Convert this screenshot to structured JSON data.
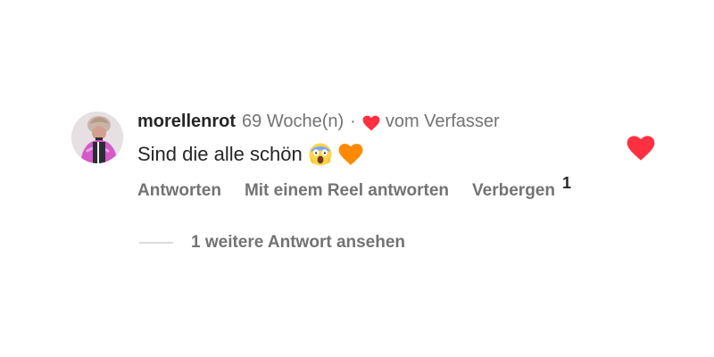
{
  "comment": {
    "username": "morellenrot",
    "timestamp": "69 Woche(n)",
    "separator": "·",
    "author_like_label": "vom Verfasser",
    "text": "Sind die alle schön",
    "emoji": [
      "face-screaming-in-fear",
      "orange-heart"
    ],
    "actions": {
      "reply_label": "Antworten",
      "reel_reply_label": "Mit einem Reel antworten",
      "hide_label": "Verbergen",
      "hide_count": "1"
    },
    "view_replies_label": "1 weitere Antwort ansehen",
    "like_icon": "heart-filled",
    "colors": {
      "heart_red": "#ff3040",
      "emoji_orange": "#ff8a00",
      "secondary_text": "#737373",
      "primary_text": "#262626"
    }
  }
}
